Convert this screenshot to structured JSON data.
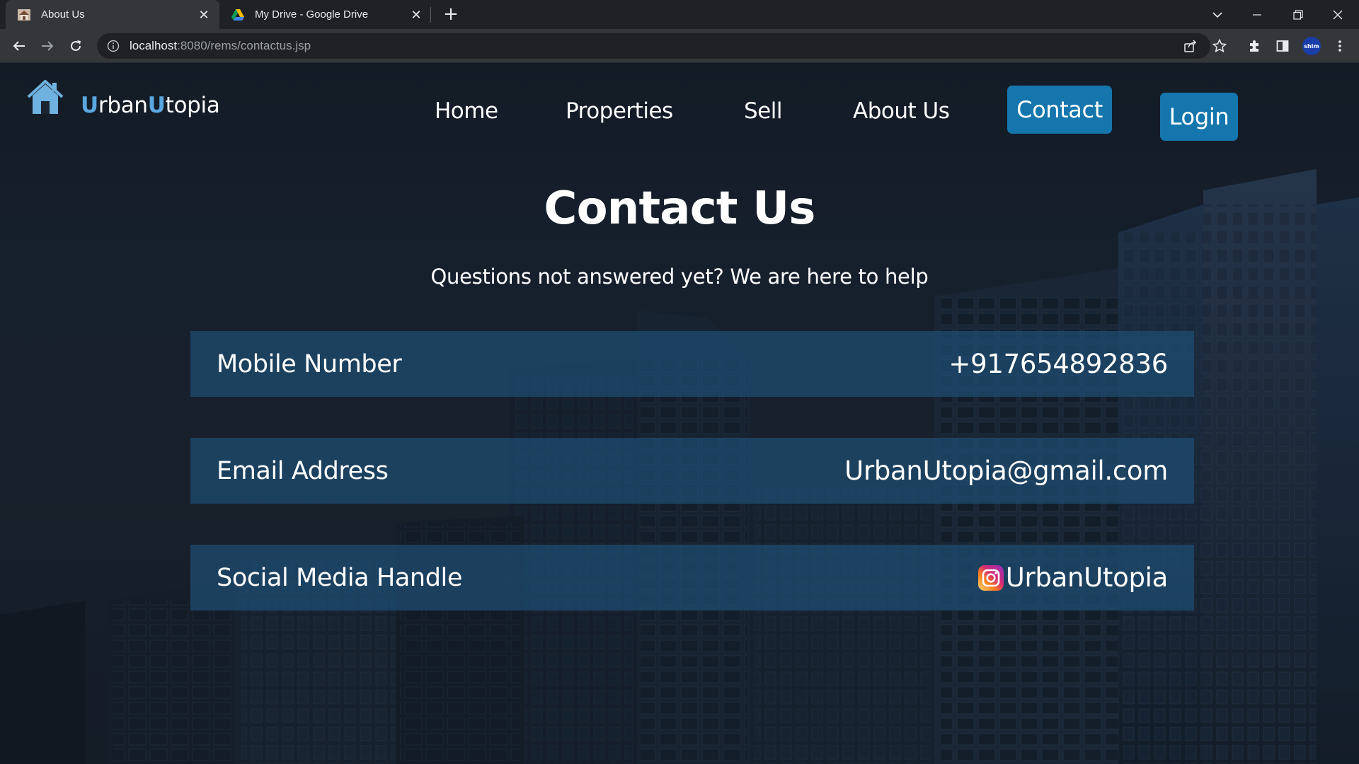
{
  "browser": {
    "tabs": [
      {
        "title": "About Us",
        "active": true,
        "favicon": "house-photo-favicon"
      },
      {
        "title": "My Drive - Google Drive",
        "active": false,
        "favicon": "google-drive-favicon"
      }
    ],
    "url": {
      "host": "localhost",
      "path": ":8080/rems/contactus.jsp"
    },
    "profile_badge": "shim"
  },
  "site": {
    "brand": {
      "first_initial": "U",
      "first_rest": "rban",
      "second_initial": "U",
      "second_rest": "topia"
    },
    "nav": {
      "home": "Home",
      "properties": "Properties",
      "sell": "Sell",
      "about": "About Us",
      "contact": "Contact",
      "login": "Login"
    },
    "accent_color": "#1576ad",
    "brand_color": "#5aa7df"
  },
  "contact": {
    "title": "Contact Us",
    "subtitle": "Questions not answered yet? We are here to help",
    "rows": [
      {
        "label": "Mobile Number",
        "value": "+917654892836"
      },
      {
        "label": "Email Address",
        "value": "UrbanUtopia@gmail.com"
      },
      {
        "label": "Social Media Handle",
        "value": "UrbanUtopia",
        "icon": "instagram-icon"
      }
    ]
  }
}
